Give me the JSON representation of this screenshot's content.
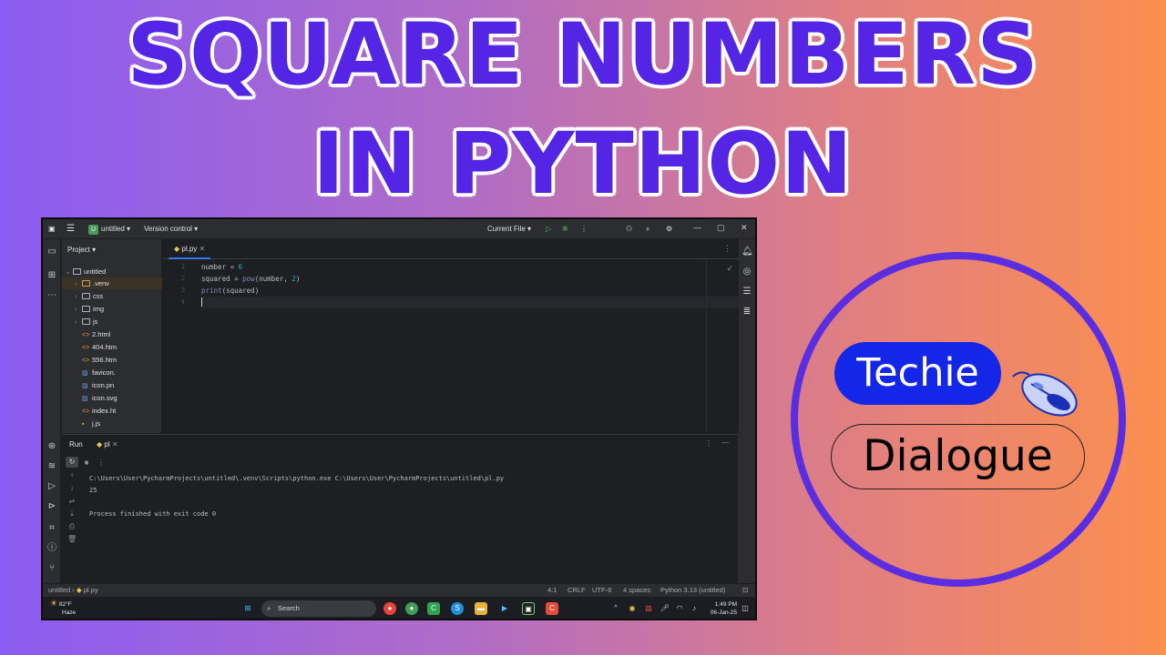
{
  "headline": {
    "line1": "SQUARE NUMBERS",
    "line2": "IN PYTHON"
  },
  "ide": {
    "titlebar": {
      "project_badge": "U",
      "project_name": "untitled",
      "vcs": "Version control",
      "run_config": "Current File"
    },
    "project_panel": {
      "header": "Project",
      "items": [
        {
          "label": "untitled",
          "kind": "folder"
        },
        {
          "label": ".venv",
          "kind": "folder"
        },
        {
          "label": "css",
          "kind": "folder"
        },
        {
          "label": "img",
          "kind": "folder"
        },
        {
          "label": "js",
          "kind": "folder"
        },
        {
          "label": "2.html",
          "kind": "html"
        },
        {
          "label": "404.htm",
          "kind": "html"
        },
        {
          "label": "556.htm",
          "kind": "html"
        },
        {
          "label": "favicon.",
          "kind": "image"
        },
        {
          "label": "icon.pn",
          "kind": "image"
        },
        {
          "label": "icon.svg",
          "kind": "image"
        },
        {
          "label": "index.ht",
          "kind": "html"
        },
        {
          "label": "j.js",
          "kind": "js"
        }
      ]
    },
    "editor": {
      "tab": "pl.py",
      "line_numbers": [
        "1",
        "2",
        "3",
        "4"
      ],
      "code": {
        "line1_a": "number = ",
        "line1_b": "6",
        "line2_a": "squared = ",
        "line2_fn": "pow",
        "line2_b": "(number, ",
        "line2_num": "2",
        "line2_c": ")",
        "line3_fn": "print",
        "line3_b": "(squared)"
      }
    },
    "run": {
      "title": "Run",
      "tab": "pl",
      "console": [
        "C:\\Users\\User\\PycharmProjects\\untitled\\.venv\\Scripts\\python.exe C:\\Users\\User\\PycharmProjects\\untitled\\pl.py",
        "25",
        "",
        "Process finished with exit code 0"
      ]
    },
    "statusbar": {
      "crumb1": "untitled",
      "crumb2": "pl.py",
      "position": "4:1",
      "line_ending": "CRLF",
      "encoding": "UTF-8",
      "indent": "4 spaces",
      "interpreter": "Python 3.13 (untitled)"
    },
    "taskbar": {
      "temperature": "82°F",
      "weather": "Haze",
      "search": "Search",
      "time": "1:49 PM",
      "date": "06-Jan-25"
    }
  },
  "logo": {
    "word1": "Techie",
    "word2": "Dialogue"
  },
  "colors": {
    "headline_fill": "#5525e6",
    "ring": "#5a2de0",
    "techie_pill": "#1426e8",
    "accent_tab": "#3574f0"
  }
}
